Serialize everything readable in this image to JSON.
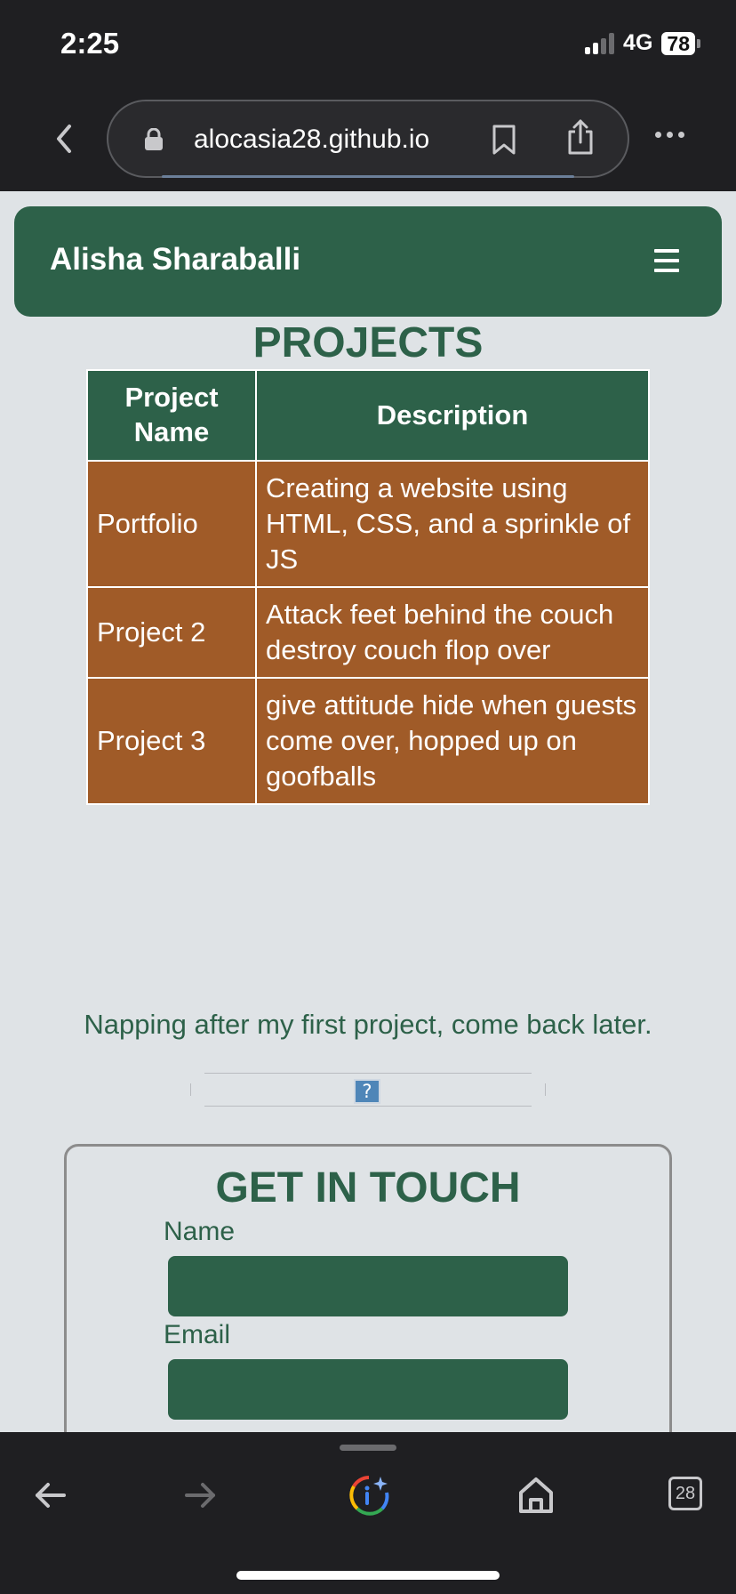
{
  "status_bar": {
    "time": "2:25",
    "network": "4G",
    "battery": "78"
  },
  "browser": {
    "url": "alocasia28.github.io",
    "tab_count": "28"
  },
  "header": {
    "site_name": "Alisha Sharaballi",
    "menu_icon": "hamburger-icon"
  },
  "projects": {
    "title": "PROJECTS",
    "columns": [
      "Project Name",
      "Description"
    ],
    "rows": [
      {
        "name": "Portfolio",
        "description": "Creating a website using HTML, CSS, and a sprinkle of JS"
      },
      {
        "name": "Project 2",
        "description": "Attack feet behind the couch destroy couch flop over"
      },
      {
        "name": "Project 3",
        "description": "give attitude hide when guests come over, hopped up on goofballs"
      }
    ]
  },
  "nap_message": "Napping after my first project, come back later.",
  "broken_embed_glyph": "?",
  "contact": {
    "title": "GET IN TOUCH",
    "name_label": "Name",
    "email_label": "Email",
    "name_value": "",
    "email_value": ""
  },
  "colors": {
    "brand_green": "#2d6149",
    "table_rust": "#a05b28",
    "page_bg": "#dfe3e6"
  }
}
